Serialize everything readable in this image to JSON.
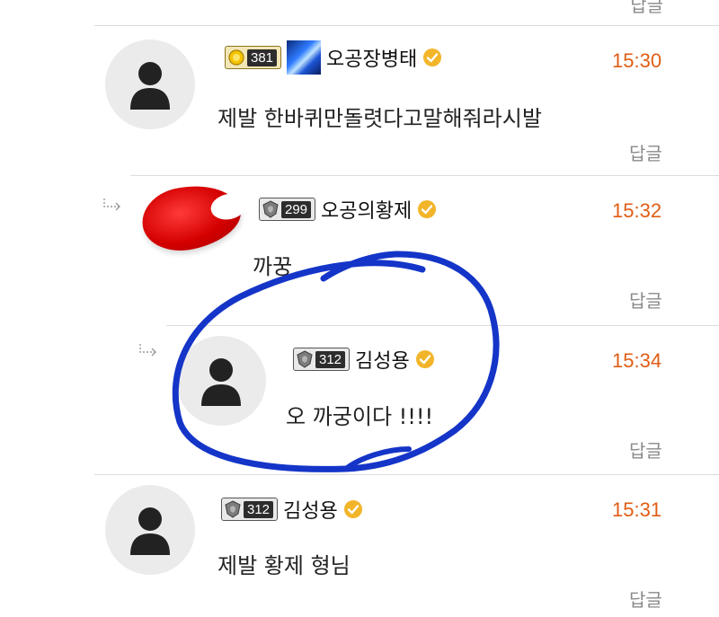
{
  "reply_label": "답글",
  "comments": [
    {
      "level": "381",
      "nickname": "오공장병태",
      "time": "15:30",
      "text": "제발 한바퀴만돌렷다고말해줘라시발"
    },
    {
      "level": "299",
      "nickname": "오공의황제",
      "time": "15:32",
      "text": "까꿍"
    },
    {
      "level": "312",
      "nickname": "김성용",
      "time": "15:34",
      "text": "오 까궁이다 !!!!"
    },
    {
      "level": "312",
      "nickname": "김성용",
      "time": "15:31",
      "text": "제발 황제 형님"
    }
  ],
  "colors": {
    "time": "#e05d15",
    "verified": "#f2b52a",
    "annotation": "#1435c8"
  },
  "icons": {
    "reply_arrow": "reply-arrow-icon",
    "verified": "verified-icon",
    "avatar": "default-avatar-icon"
  }
}
